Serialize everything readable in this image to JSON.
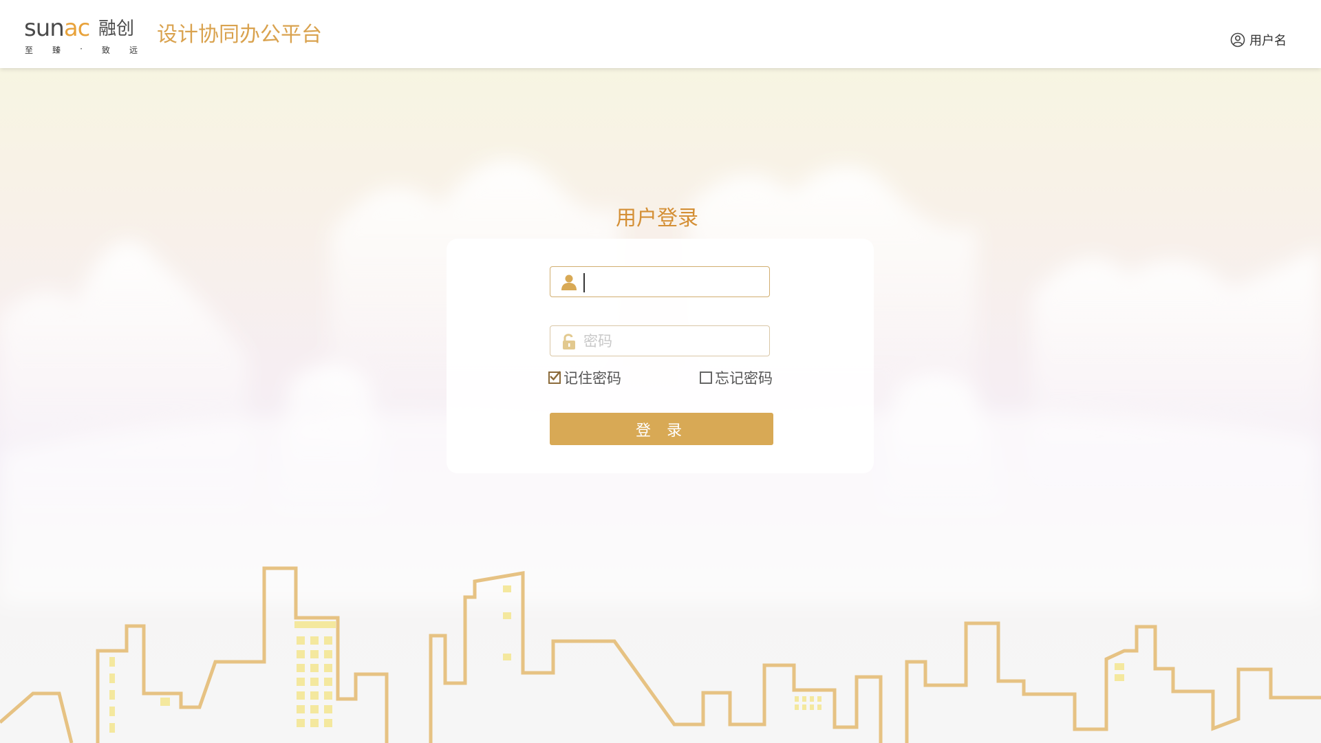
{
  "header": {
    "logo": {
      "word_left": "SUN",
      "word_right": "AC",
      "cn": "融创",
      "slogan": [
        "至",
        "臻",
        "·",
        "致",
        "远"
      ]
    },
    "platform_title": "设计协同办公平台",
    "user_label": "用户名"
  },
  "login": {
    "title": "用户登录",
    "username": {
      "value": "",
      "placeholder": ""
    },
    "password": {
      "value": "",
      "placeholder": "密码"
    },
    "remember_label": "记住密码",
    "remember_checked": true,
    "forget_label": "忘记密码",
    "forget_checked": false,
    "submit_label": "登 录"
  },
  "colors": {
    "brand_gold": "#d8a955",
    "title_gold": "#d48f35",
    "building_stroke": "#e6c283",
    "window_yellow": "#f4e89e"
  },
  "icons": {
    "user": "user-circle-icon",
    "username_field": "person-icon",
    "password_field": "lock-icon",
    "checkbox": "checkbox-icon"
  }
}
